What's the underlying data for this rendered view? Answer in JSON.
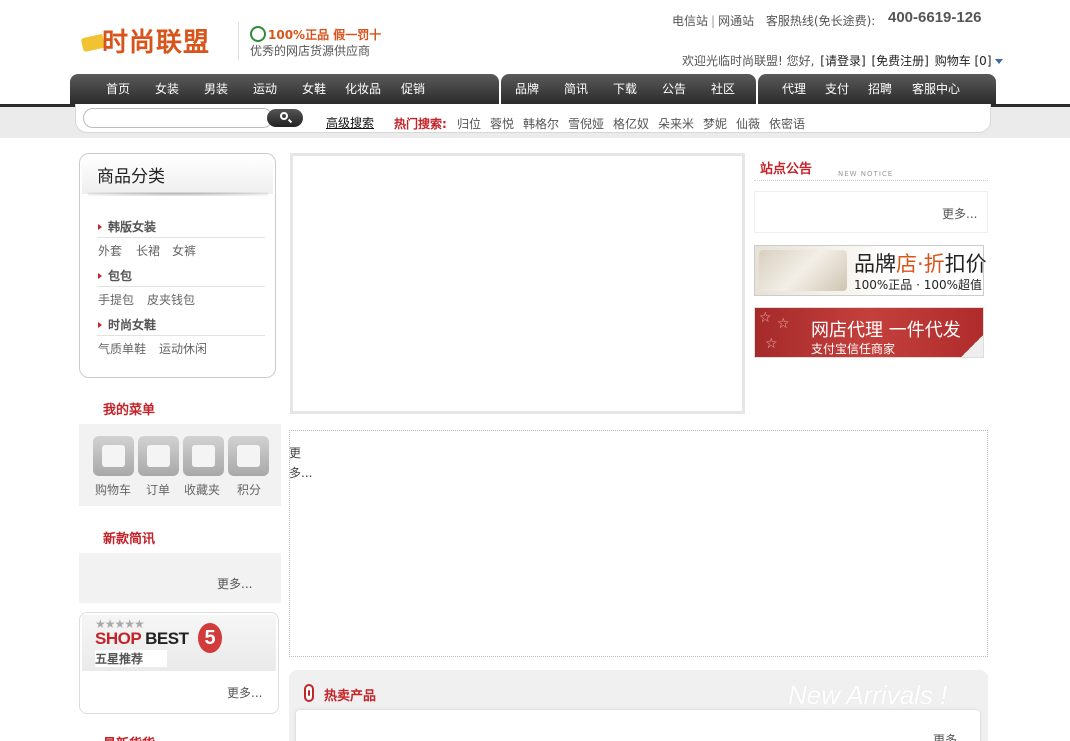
{
  "header": {
    "logo_text": "时尚联盟",
    "slogan_main": "100%正品 假一罚十",
    "slogan_sub": "优秀的网店货源供应商",
    "links": [
      "电信站",
      "网通站"
    ],
    "hotline_label": "客服热线(免长途费):",
    "hotline": "400-6619-126",
    "welcome": "欢迎光临时尚联盟! 您好,",
    "login": "[请登录]",
    "register": "[免费注册]",
    "cart": "购物车 [0]"
  },
  "nav": {
    "group1": [
      "首页",
      "女装",
      "男装",
      "运动",
      "女鞋",
      "化妆品",
      "促销"
    ],
    "group2": [
      "品牌",
      "简讯",
      "下载",
      "公告",
      "社区"
    ],
    "group3": [
      "代理",
      "支付",
      "招聘",
      "客服中心"
    ]
  },
  "search": {
    "placeholder": "",
    "advanced": "高级搜索",
    "hot_label": "热门搜索:",
    "hot_words": [
      "归位",
      "蓉悦",
      "韩格尔",
      "雪倪娅",
      "格亿奴",
      "朵来米",
      "梦妮",
      "仙薇",
      "依密语"
    ]
  },
  "categories": {
    "title": "商品分类",
    "groups": [
      {
        "name": "韩版女装",
        "items": [
          "外套",
          "长裙",
          "女裤"
        ]
      },
      {
        "name": "包包",
        "items": [
          "手提包",
          "皮夹钱包"
        ]
      },
      {
        "name": "时尚女鞋",
        "items": [
          "气质单鞋",
          "运动休闲"
        ]
      }
    ]
  },
  "my_menu": {
    "title": "我的菜单",
    "items": [
      {
        "label": "购物车",
        "icon": "database-icon"
      },
      {
        "label": "订单",
        "icon": "printer-icon"
      },
      {
        "label": "收藏夹",
        "icon": "book-icon"
      },
      {
        "label": "积分",
        "icon": "picture-icon"
      }
    ]
  },
  "news": {
    "title": "新款简讯",
    "more": "更多..."
  },
  "best": {
    "stars": "★★★★★",
    "brand_red": "SHOP",
    "brand_dark": "BEST",
    "number": "5",
    "subtitle": "五星推荐",
    "more": "更多..."
  },
  "next_section": {
    "title": "最新货货"
  },
  "center": {
    "dotted_text": "更多...",
    "hot_title": "热卖产品",
    "new_arrivals": "New Arrivals !",
    "hot_more": "更多"
  },
  "notice": {
    "title": "站点公告",
    "subtitle_en": "NEW NOTICE",
    "more": "更多..."
  },
  "ads": {
    "ad1_main_a": "品牌",
    "ad1_main_b": "店·折",
    "ad1_main_c": "扣价",
    "ad1_sub": "100%正品 · 100%超值",
    "ad2_main": "网店代理 一件代发",
    "ad2_sub": "支付宝信任商家"
  },
  "colors": {
    "accent_red": "#c3242a",
    "logo_orange": "#d8541a",
    "nav_dark": "#2b2b2b"
  }
}
